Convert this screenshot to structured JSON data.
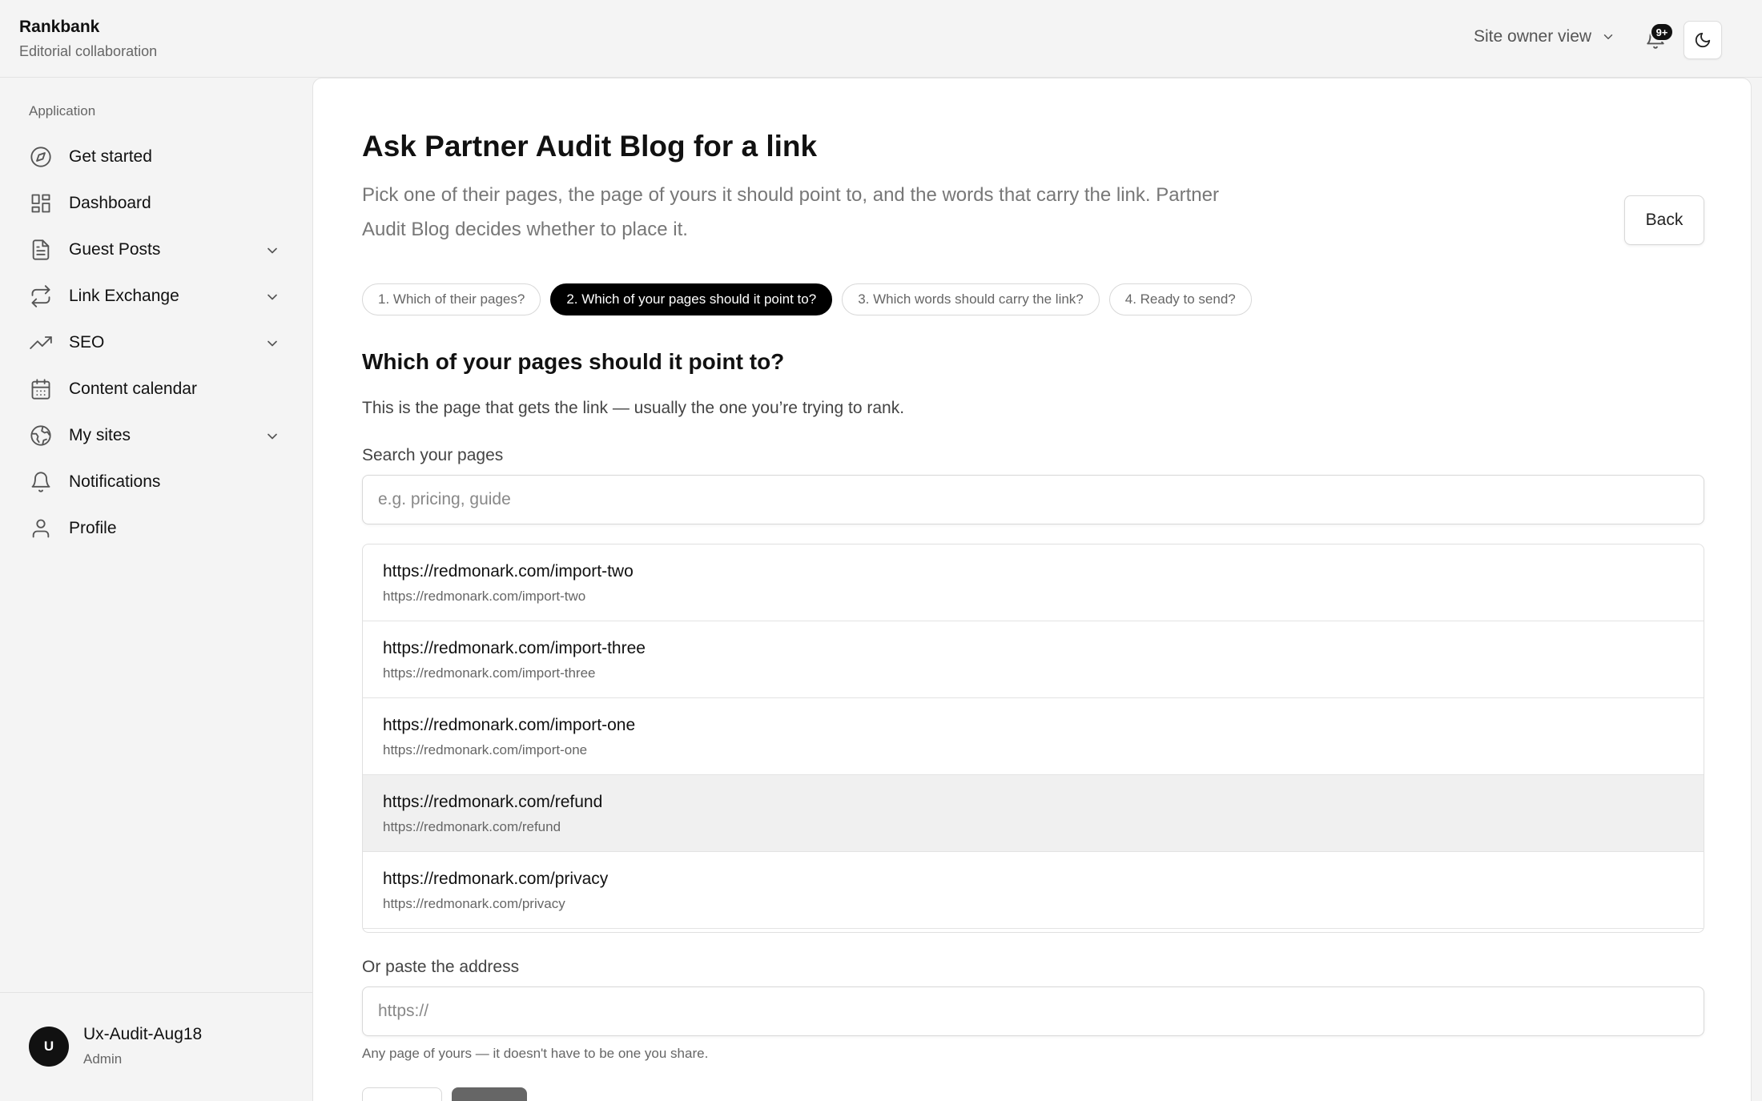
{
  "app": {
    "name": "Rankbank",
    "subtitle": "Editorial collaboration"
  },
  "topbar": {
    "view_label": "Site owner view",
    "notification_badge": "9+"
  },
  "sidebar": {
    "section_label": "Application",
    "items": [
      {
        "label": "Get started",
        "icon": "compass-icon",
        "has_chevron": false
      },
      {
        "label": "Dashboard",
        "icon": "grid-icon",
        "has_chevron": false
      },
      {
        "label": "Guest Posts",
        "icon": "document-icon",
        "has_chevron": true
      },
      {
        "label": "Link Exchange",
        "icon": "repeat-icon",
        "has_chevron": true
      },
      {
        "label": "SEO",
        "icon": "trending-up-icon",
        "has_chevron": true
      },
      {
        "label": "Content calendar",
        "icon": "calendar-icon",
        "has_chevron": false
      },
      {
        "label": "My sites",
        "icon": "globe-icon",
        "has_chevron": true
      },
      {
        "label": "Notifications",
        "icon": "bell-icon",
        "has_chevron": false
      },
      {
        "label": "Profile",
        "icon": "user-icon",
        "has_chevron": false
      }
    ],
    "user": {
      "initial": "U",
      "name": "Ux-Audit-Aug18",
      "role": "Admin"
    }
  },
  "main": {
    "title": "Ask Partner Audit Blog for a link",
    "description": "Pick one of their pages, the page of yours it should point to, and the words that carry the link. Partner Audit Blog decides whether to place it.",
    "back_label": "Back",
    "steps": [
      {
        "label": "1. Which of their pages?",
        "active": false
      },
      {
        "label": "2. Which of your pages should it point to?",
        "active": true
      },
      {
        "label": "3. Which words should carry the link?",
        "active": false
      },
      {
        "label": "4. Ready to send?",
        "active": false
      }
    ],
    "section_title": "Which of your pages should it point to?",
    "section_description": "This is the page that gets the link — usually the one you’re trying to rank.",
    "search": {
      "label": "Search your pages",
      "placeholder": "e.g. pricing, guide",
      "value": ""
    },
    "pages": [
      {
        "title": "https://redmonark.com/import-two",
        "url": "https://redmonark.com/import-two",
        "selected": false
      },
      {
        "title": "https://redmonark.com/import-three",
        "url": "https://redmonark.com/import-three",
        "selected": false
      },
      {
        "title": "https://redmonark.com/import-one",
        "url": "https://redmonark.com/import-one",
        "selected": false
      },
      {
        "title": "https://redmonark.com/refund",
        "url": "https://redmonark.com/refund",
        "selected": true
      },
      {
        "title": "https://redmonark.com/privacy",
        "url": "https://redmonark.com/privacy",
        "selected": false
      }
    ],
    "paste": {
      "label": "Or paste the address",
      "placeholder": "https://",
      "value": ""
    },
    "hint": "Any page of yours — it doesn't have to be one you share."
  }
}
